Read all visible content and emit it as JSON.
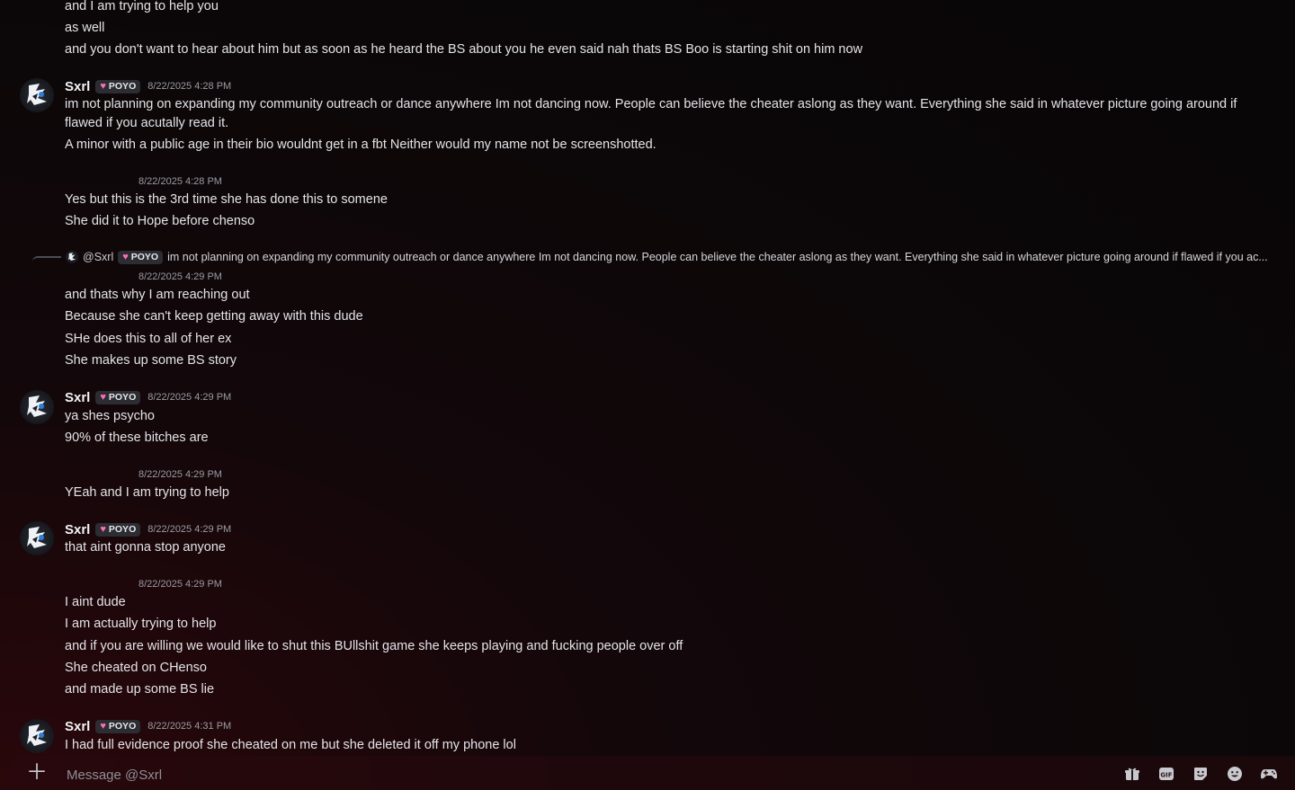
{
  "messages": {
    "m0": {
      "lines": [
        "and I am trying to help you",
        "as well",
        "and you don't want to hear about him but as soon as he heard the BS about you he even said nah thats BS Boo is starting shit on him now"
      ]
    },
    "m1": {
      "author": "Sxrl",
      "role_tag": "POYO",
      "timestamp": "8/22/2025 4:28 PM",
      "lines": [
        "im not planning on expanding my community outreach or dance anywhere Im not dancing now. People can believe the cheater aslong as they want. Everything she said in whatever picture going around if flawed if you acutally read it.",
        "A minor with a public age in  their bio wouldnt get in a fbt Neither would my name not be screenshotted."
      ]
    },
    "m2": {
      "timestamp": "8/22/2025 4:28 PM",
      "lines": [
        "Yes but this is the 3rd time she has done this to somene",
        "She did it to Hope before chenso"
      ]
    },
    "m3": {
      "reply_mention": "@Sxrl",
      "reply_tag": "POYO",
      "reply_text": "im not planning on expanding my community outreach or dance anywhere Im not dancing now. People can believe the cheater aslong as they want. Everything she said in whatever picture going around if flawed if you ac...",
      "timestamp": "8/22/2025 4:29 PM",
      "lines": [
        "and thats why I am reaching out",
        "Because she can't keep getting away with this dude",
        "SHe does this to all of her ex",
        "She makes up some BS story"
      ]
    },
    "m4": {
      "author": "Sxrl",
      "role_tag": "POYO",
      "timestamp": "8/22/2025 4:29 PM",
      "lines": [
        "ya shes psycho",
        "90% of these bitches are"
      ]
    },
    "m5": {
      "timestamp": "8/22/2025 4:29 PM",
      "lines": [
        "YEah and I am trying to help"
      ]
    },
    "m6": {
      "author": "Sxrl",
      "role_tag": "POYO",
      "timestamp": "8/22/2025 4:29 PM",
      "lines": [
        "that aint gonna stop anyone"
      ]
    },
    "m7": {
      "timestamp": "8/22/2025 4:29 PM",
      "lines": [
        "I aint dude",
        "I am actually trying to help",
        "and if you are willing we would like to shut this BUllshit game she keeps playing and fucking people over off",
        "She cheated on CHenso",
        "and made up some BS lie"
      ]
    },
    "m8": {
      "author": "Sxrl",
      "role_tag": "POYO",
      "timestamp": "8/22/2025 4:31 PM",
      "lines": [
        "I had full evidence proof she cheated on me but she deleted it off my phone lol"
      ]
    }
  },
  "composer": {
    "placeholder": "Message @Sxrl",
    "tools": [
      "gift-icon",
      "gif-icon",
      "sticker-icon",
      "emoji-icon",
      "activities-icon"
    ]
  },
  "colors": {
    "tag_heart": "#ff6fb5",
    "background": "#0b0708"
  }
}
